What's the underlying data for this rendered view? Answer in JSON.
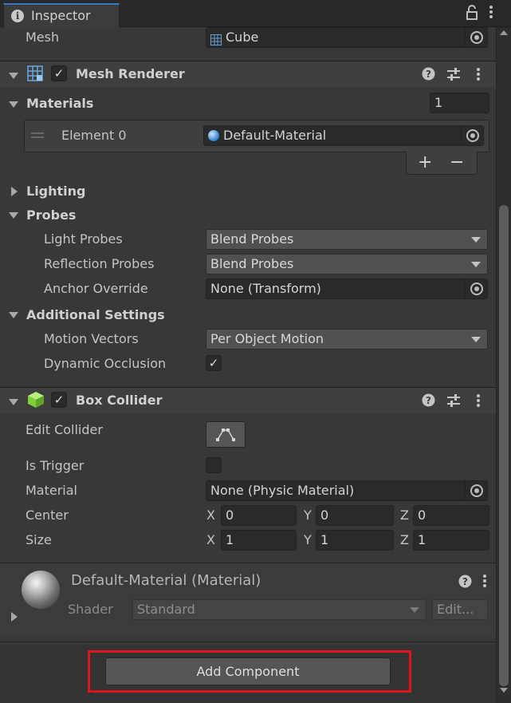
{
  "window": {
    "tab_title": "Inspector"
  },
  "mesh_filter": {
    "mesh_label": "Mesh",
    "mesh_value": "Cube"
  },
  "mesh_renderer": {
    "title": "Mesh Renderer",
    "enabled": true,
    "materials_label": "Materials",
    "materials_count": "1",
    "element_label": "Element 0",
    "element_value": "Default-Material",
    "add_label": "+",
    "remove_label": "−",
    "lighting_label": "Lighting",
    "probes_label": "Probes",
    "light_probes_label": "Light Probes",
    "light_probes_value": "Blend Probes",
    "reflection_probes_label": "Reflection Probes",
    "reflection_probes_value": "Blend Probes",
    "anchor_override_label": "Anchor Override",
    "anchor_override_value": "None (Transform)",
    "additional_settings_label": "Additional Settings",
    "motion_vectors_label": "Motion Vectors",
    "motion_vectors_value": "Per Object Motion",
    "dynamic_occlusion_label": "Dynamic Occlusion",
    "dynamic_occlusion": true
  },
  "box_collider": {
    "title": "Box Collider",
    "enabled": true,
    "edit_collider_label": "Edit Collider",
    "is_trigger_label": "Is Trigger",
    "is_trigger": false,
    "material_label": "Material",
    "material_value": "None (Physic Material)",
    "center_label": "Center",
    "size_label": "Size",
    "axis_x": "X",
    "axis_y": "Y",
    "axis_z": "Z",
    "center": {
      "x": "0",
      "y": "0",
      "z": "0"
    },
    "size": {
      "x": "1",
      "y": "1",
      "z": "1"
    }
  },
  "material_preview": {
    "title": "Default-Material (Material)",
    "shader_label": "Shader",
    "shader_value": "Standard",
    "edit_label": "Edit..."
  },
  "footer": {
    "add_component_label": "Add Component",
    "highlight_color": "#e0141b"
  },
  "icons": {
    "tab_info": "info-icon",
    "lock": "lock-icon",
    "menu": "kebab-menu-icon",
    "help": "help-icon",
    "preset": "preset-sliders-icon",
    "object_picker": "object-picker-icon"
  },
  "colors": {
    "background": "#383838",
    "field": "#2a2a2a",
    "accent": "#3a79bb"
  }
}
